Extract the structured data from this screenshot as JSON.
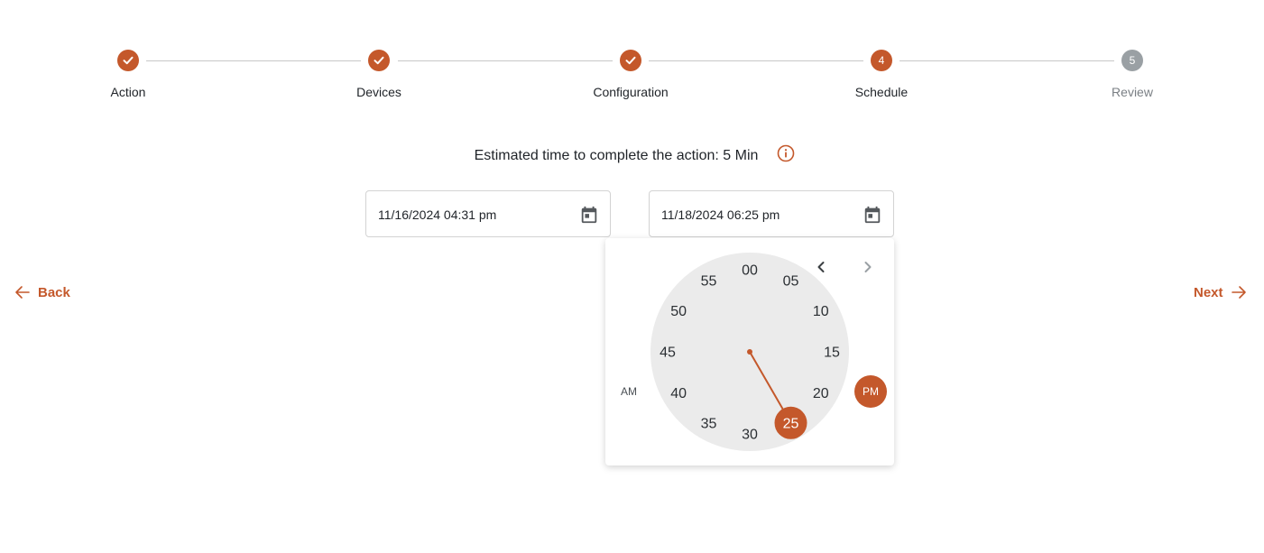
{
  "stepper": {
    "steps": [
      {
        "label": "Action",
        "status": "complete"
      },
      {
        "label": "Devices",
        "status": "complete"
      },
      {
        "label": "Configuration",
        "status": "complete"
      },
      {
        "label": "Schedule",
        "status": "active",
        "number": "4"
      },
      {
        "label": "Review",
        "status": "pending",
        "number": "5"
      }
    ]
  },
  "estimate": {
    "text": "Estimated time to complete the action: 5 Min",
    "icon": "info-icon"
  },
  "start_field": {
    "value": "11/16/2024 04:31 pm",
    "icon": "calendar-icon"
  },
  "end_field": {
    "value": "11/18/2024 06:25 pm",
    "icon": "calendar-icon"
  },
  "nav": {
    "back_label": "Back",
    "next_label": "Next"
  },
  "picker": {
    "am_label": "AM",
    "pm_label": "PM",
    "selected_period": "PM",
    "selected_minute": "25",
    "minutes": [
      "00",
      "05",
      "10",
      "15",
      "20",
      "25",
      "30",
      "35",
      "40",
      "45",
      "50",
      "55"
    ]
  },
  "colors": {
    "accent": "#c4582b",
    "pending": "#9aa0a4",
    "clock_face": "#ebebeb"
  }
}
